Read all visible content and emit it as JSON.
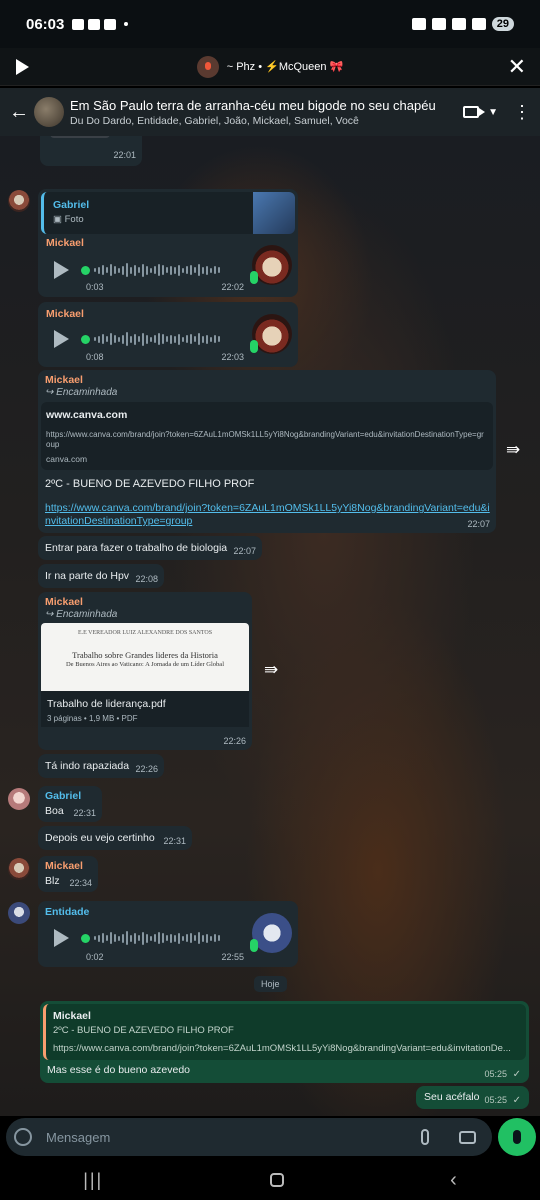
{
  "statusbar": {
    "time": "06:03",
    "battery": "29"
  },
  "call": {
    "participants": "~ Phz • ⚡McQueen 🎀"
  },
  "header": {
    "title": "Em São Paulo terra de arranha-céu meu bigode no seu chapéu",
    "members": "Du Do Dardo, Entidade, Gabriel, João, Mickael, Samuel, Você"
  },
  "messages": {
    "m0": {
      "time": "22:01"
    },
    "m1": {
      "quote_sender": "Gabriel",
      "quote_type": "Foto",
      "sender": "Mickael",
      "duration": "0:03",
      "time": "22:02"
    },
    "m2": {
      "sender": "Mickael",
      "duration": "0:08",
      "time": "22:03"
    },
    "m3": {
      "sender": "Mickael",
      "forwarded": "Encaminhada",
      "preview_title": "www.canva.com",
      "preview_url": "https://www.canva.com/brand/join?token=6ZAuL1mOMSk1LL5yYi8Nog&brandingVariant=edu&invitationDestinationType=group",
      "preview_domain": "canva.com",
      "text": "2ºC - BUENO DE AZEVEDO FILHO PROF",
      "link": "https://www.canva.com/brand/join?token=6ZAuL1mOMSk1LL5yYi8Nog&brandingVariant=edu&invitationDestinationType=group",
      "time": "22:07"
    },
    "m4": {
      "text": "Entrar para fazer o trabalho de biologia",
      "time": "22:07"
    },
    "m5": {
      "text": "Ir na parte do Hpv",
      "time": "22:08"
    },
    "m6": {
      "sender": "Mickael",
      "forwarded": "Encaminhada",
      "doc_header": "E.E VEREADOR LUIZ ALEXANDRE DOS SANTOS",
      "doc_line1": "Trabalho sobre Grandes lideres da Historia",
      "doc_line2": "De Buenos Aires ao Vaticano: A Jornada de um Líder Global",
      "file_name": "Trabalho de liderança.pdf",
      "file_meta": "3 páginas • 1,9 MB • PDF",
      "time": "22:26"
    },
    "m7": {
      "text": "Tá indo rapaziada",
      "time": "22:26"
    },
    "m8": {
      "sender": "Gabriel",
      "text": "Boa",
      "time": "22:31"
    },
    "m9": {
      "text": "Depois eu vejo certinho",
      "time": "22:31"
    },
    "m10": {
      "sender": "Mickael",
      "text": "Blz",
      "time": "22:34"
    },
    "m11": {
      "sender": "Entidade",
      "duration": "0:02",
      "time": "22:55"
    },
    "date_chip": "Hoje",
    "m12": {
      "quote_sender": "Mickael",
      "quote_text": "2ºC - BUENO DE AZEVEDO FILHO PROF",
      "quote_url": "https://www.canva.com/brand/join?token=6ZAuL1mOMSk1LL5yYi8Nog&brandingVariant=edu&invitationDe...",
      "text": "Mas esse é do bueno azevedo",
      "time": "05:25"
    },
    "m13": {
      "text": "Seu acéfalo",
      "time": "05:25"
    }
  },
  "input": {
    "placeholder": "Mensagem"
  },
  "colors": {
    "accent": "#25d366",
    "outgoing": "#144d37",
    "incoming": "#1f2a30",
    "link": "#53bdeb"
  }
}
